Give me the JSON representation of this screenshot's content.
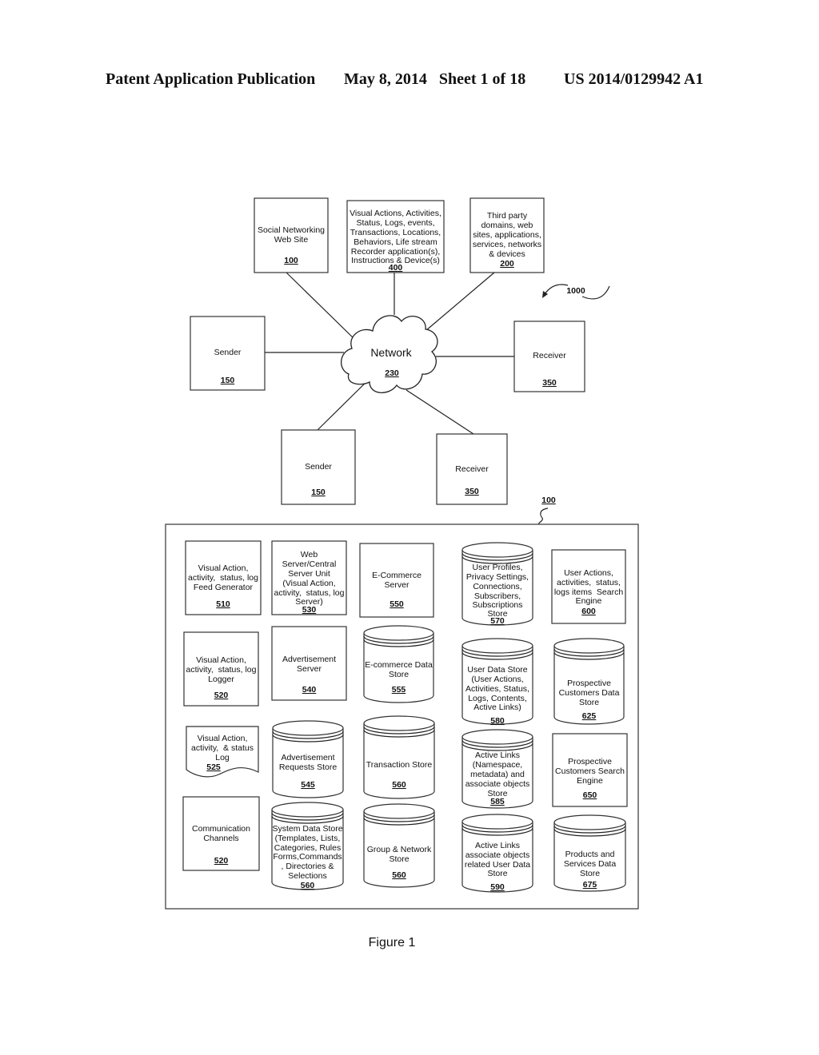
{
  "header": {
    "left": "Patent Application Publication",
    "middle": "May 8, 2014   Sheet 1 of 18",
    "right": "US 2014/0129942 A1"
  },
  "figure_caption": "Figure 1",
  "system_ref": "1000",
  "platform_ref": "100",
  "network": {
    "label": "Network",
    "ref": "230"
  },
  "top_nodes": [
    {
      "id": "social",
      "lines": [
        "Social Networking",
        "Web Site"
      ],
      "ref": "100"
    },
    {
      "id": "recorder",
      "lines": [
        "Visual Actions, Activities,",
        "Status, Logs, events,",
        "Transactions, Locations,",
        "Behaviors, Life stream",
        "Recorder application(s),",
        "Instructions & Device(s)"
      ],
      "ref": "400"
    },
    {
      "id": "thirdparty",
      "lines": [
        "Third party",
        "domains, web",
        "sites, applications,",
        "services, networks",
        "& devices"
      ],
      "ref": "200"
    },
    {
      "id": "sender1",
      "lines": [
        "Sender"
      ],
      "ref": "150"
    },
    {
      "id": "receiver1",
      "lines": [
        "Receiver"
      ],
      "ref": "350"
    },
    {
      "id": "sender2",
      "lines": [
        "Sender"
      ],
      "ref": "150"
    },
    {
      "id": "receiver2",
      "lines": [
        "Receiver"
      ],
      "ref": "350"
    }
  ],
  "components": [
    {
      "id": "c510",
      "shape": "box",
      "lines": [
        "Visual Action,",
        "activity,  status, log",
        "Feed Generator"
      ],
      "ref": "510"
    },
    {
      "id": "c530",
      "shape": "box",
      "lines": [
        "Web",
        "Server/Central",
        "Server Unit",
        "(Visual Action,",
        "activity,  status, log",
        "Server)"
      ],
      "ref": "530"
    },
    {
      "id": "c550",
      "shape": "box",
      "lines": [
        "E-Commerce",
        "Server"
      ],
      "ref": "550"
    },
    {
      "id": "c570",
      "shape": "cylinder",
      "lines": [
        "User Profiles,",
        "Privacy Settings,",
        "Connections,",
        "Subscribers,",
        "Subscriptions",
        "Store"
      ],
      "ref": "570"
    },
    {
      "id": "c600",
      "shape": "box",
      "lines": [
        "User Actions,",
        "activities,  status,",
        "logs items  Search",
        "Engine"
      ],
      "ref": "600"
    },
    {
      "id": "c520a",
      "shape": "box",
      "lines": [
        "Visual Action,",
        "activity,  status, log",
        "Logger"
      ],
      "ref": "520"
    },
    {
      "id": "c540",
      "shape": "box",
      "lines": [
        "Advertisement",
        "Server"
      ],
      "ref": "540"
    },
    {
      "id": "c555",
      "shape": "cylinder",
      "lines": [
        "E-commerce Data",
        "Store"
      ],
      "ref": "555"
    },
    {
      "id": "c580",
      "shape": "cylinder",
      "lines": [
        "User Data Store",
        "(User Actions,",
        "Activities, Status,",
        "Logs, Contents,",
        "Active Links)"
      ],
      "ref": "580"
    },
    {
      "id": "c625",
      "shape": "cylinder",
      "lines": [
        "Prospective",
        "Customers Data",
        "Store"
      ],
      "ref": "625"
    },
    {
      "id": "c525",
      "shape": "document",
      "lines": [
        "Visual Action,",
        "activity,  & status",
        "Log"
      ],
      "ref": "525"
    },
    {
      "id": "c545",
      "shape": "cylinder",
      "lines": [
        "Advertisement",
        "Requests Store"
      ],
      "ref": "545"
    },
    {
      "id": "c560a",
      "shape": "cylinder",
      "lines": [
        "Transaction Store"
      ],
      "ref": "560"
    },
    {
      "id": "c585",
      "shape": "cylinder",
      "lines": [
        "Active Links",
        "(Namespace,",
        "metadata) and",
        "associate objects",
        "Store"
      ],
      "ref": "585"
    },
    {
      "id": "c650",
      "shape": "box",
      "lines": [
        "Prospective",
        "Customers Search",
        "Engine"
      ],
      "ref": "650"
    },
    {
      "id": "c520b",
      "shape": "box",
      "lines": [
        "Communication",
        "Channels"
      ],
      "ref": "520"
    },
    {
      "id": "c560b",
      "shape": "cylinder",
      "lines": [
        "System Data Store",
        "(Templates, Lists,",
        "Categories, Rules",
        "Forms,Commands",
        ", Directories &",
        "Selections"
      ],
      "ref": "560"
    },
    {
      "id": "c560c",
      "shape": "cylinder",
      "lines": [
        "Group & Network",
        "Store"
      ],
      "ref": "560"
    },
    {
      "id": "c590",
      "shape": "cylinder",
      "lines": [
        "Active Links",
        "associate objects",
        "related User Data",
        "Store"
      ],
      "ref": "590"
    },
    {
      "id": "c675",
      "shape": "cylinder",
      "lines": [
        "Products and",
        "Services Data",
        "Store"
      ],
      "ref": "675"
    }
  ]
}
